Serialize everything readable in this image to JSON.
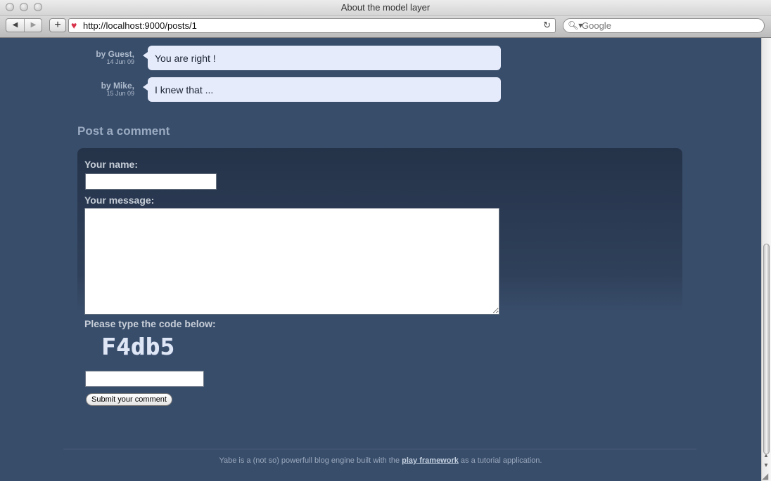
{
  "window": {
    "title": "About the model layer"
  },
  "toolbar": {
    "url": "http://localhost:9000/posts/1",
    "search_placeholder": "Google"
  },
  "comments": [
    {
      "author": "by Guest,",
      "date": "14 Jun 09",
      "text": "You are right !"
    },
    {
      "author": "by Mike,",
      "date": "15 Jun 09",
      "text": "I knew that ..."
    }
  ],
  "form": {
    "heading": "Post a comment",
    "name_label": "Your name:",
    "name_value": "",
    "message_label": "Your message:",
    "message_value": "",
    "code_label": "Please type the code below:",
    "captcha_code": "F4db5",
    "code_value": "",
    "submit_label": "Submit your comment"
  },
  "footer": {
    "text_before": "Yabe is a (not so) powerfull blog engine built with the ",
    "link_text": "play framework",
    "text_after": " as a tutorial application."
  },
  "colors": {
    "page_bg": "#384d6a",
    "form_bg_top": "#253349",
    "bubble_bg": "#e5ebfb",
    "heading": "#9aabc2"
  }
}
